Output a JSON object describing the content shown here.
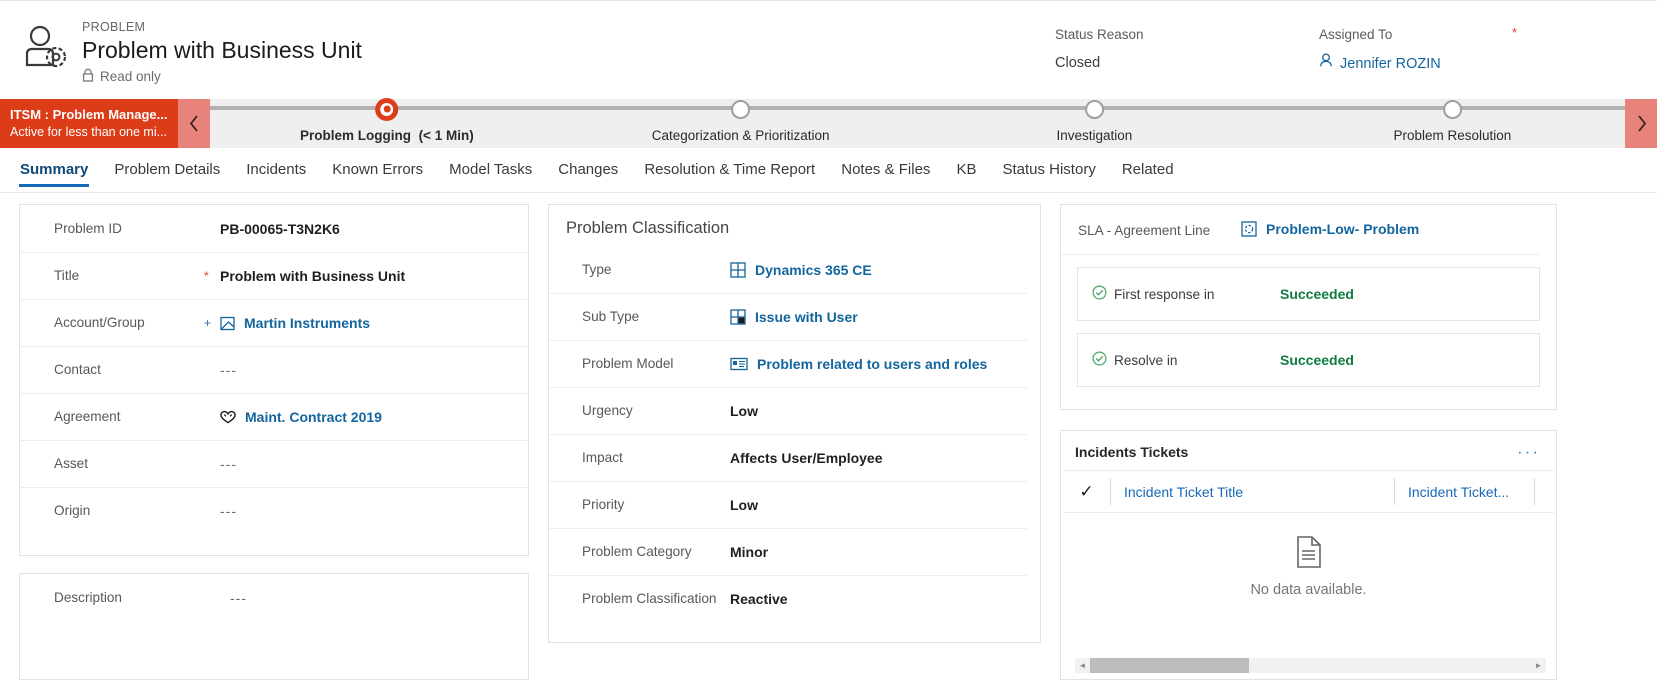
{
  "header": {
    "eyebrow": "PROBLEM",
    "title": "Problem with Business Unit",
    "readonly_label": "Read only",
    "entity_icon": "problem-person-gear-icon",
    "lock_icon": "lock-icon",
    "status_reason": {
      "label": "Status Reason",
      "value": "Closed"
    },
    "assigned_to": {
      "label": "Assigned To",
      "value": "Jennifer ROZIN",
      "icon": "user-icon"
    },
    "required_star": "*"
  },
  "process_flow": {
    "stage_block": {
      "title": "ITSM : Problem Manage...",
      "subtitle": "Active for less than one mi...",
      "color": "#dc3c17"
    },
    "prev_label": "‹",
    "next_label": "›",
    "nav_color": "#e8837b",
    "stages": [
      {
        "label": "Problem Logging",
        "duration": "(< 1 Min)",
        "active": true
      },
      {
        "label": "Categorization & Prioritization",
        "duration": "",
        "active": false
      },
      {
        "label": "Investigation",
        "duration": "",
        "active": false
      },
      {
        "label": "Problem Resolution",
        "duration": "",
        "active": false
      }
    ]
  },
  "tabs": [
    {
      "label": "Summary",
      "active": true
    },
    {
      "label": "Problem Details",
      "active": false
    },
    {
      "label": "Incidents",
      "active": false
    },
    {
      "label": "Known Errors",
      "active": false
    },
    {
      "label": "Model Tasks",
      "active": false
    },
    {
      "label": "Changes",
      "active": false
    },
    {
      "label": "Resolution & Time Report",
      "active": false
    },
    {
      "label": "Notes & Files",
      "active": false
    },
    {
      "label": "KB",
      "active": false
    },
    {
      "label": "Status History",
      "active": false
    },
    {
      "label": "Related",
      "active": false
    }
  ],
  "general": {
    "rows": [
      {
        "label": "Problem ID",
        "star": "",
        "value": "PB-00065-T3N2K6",
        "kind": "bold",
        "icon": ""
      },
      {
        "label": "Title",
        "star": "*",
        "value": "Problem with Business Unit",
        "kind": "bold",
        "icon": ""
      },
      {
        "label": "Account/Group",
        "star": "+",
        "value": "Martin Instruments",
        "kind": "link",
        "icon": "account-icon"
      },
      {
        "label": "Contact",
        "star": "",
        "value": "---",
        "kind": "empty",
        "icon": ""
      },
      {
        "label": "Agreement",
        "star": "",
        "value": "Maint. Contract 2019",
        "kind": "link",
        "icon": "agreement-icon"
      },
      {
        "label": "Asset",
        "star": "",
        "value": "---",
        "kind": "empty",
        "icon": ""
      },
      {
        "label": "Origin",
        "star": "",
        "value": "---",
        "kind": "empty",
        "icon": ""
      }
    ]
  },
  "description": {
    "label": "Description",
    "value": "---"
  },
  "classification": {
    "title": "Problem Classification",
    "rows": [
      {
        "label": "Type",
        "value": "Dynamics 365 CE",
        "kind": "link",
        "icon": "grid-icon"
      },
      {
        "label": "Sub Type",
        "value": "Issue with User",
        "kind": "link",
        "icon": "grid-filled-icon"
      },
      {
        "label": "Problem Model",
        "value": "Problem related to users and roles",
        "kind": "link",
        "icon": "card-icon"
      },
      {
        "label": "Urgency",
        "value": "Low",
        "kind": "bold",
        "icon": ""
      },
      {
        "label": "Impact",
        "value": "Affects User/Employee",
        "kind": "bold",
        "icon": ""
      },
      {
        "label": "Priority",
        "value": "Low",
        "kind": "bold",
        "icon": ""
      },
      {
        "label": "Problem Category",
        "value": "Minor",
        "kind": "bold",
        "icon": ""
      },
      {
        "label": "Problem Classification",
        "value": "Reactive",
        "kind": "bold",
        "icon": ""
      }
    ]
  },
  "sla": {
    "label": "SLA - Agreement Line",
    "value": "Problem-Low- Problem",
    "icon": "sla-icon",
    "kpis": [
      {
        "name": "First response in",
        "status": "Succeeded",
        "icon": "check-circle-icon"
      },
      {
        "name": "Resolve in",
        "status": "Succeeded",
        "icon": "check-circle-icon"
      }
    ],
    "success_color": "#107c41"
  },
  "incidents": {
    "title": "Incidents Tickets",
    "more_label": "···",
    "columns": [
      {
        "label": "✓",
        "kind": "check"
      },
      {
        "label": "Incident Ticket Title",
        "kind": "text"
      },
      {
        "label": "Incident Ticket...",
        "kind": "text"
      }
    ],
    "empty_text": "No data available.",
    "empty_icon": "document-icon",
    "scroll_left": "◄",
    "scroll_right": "►"
  }
}
